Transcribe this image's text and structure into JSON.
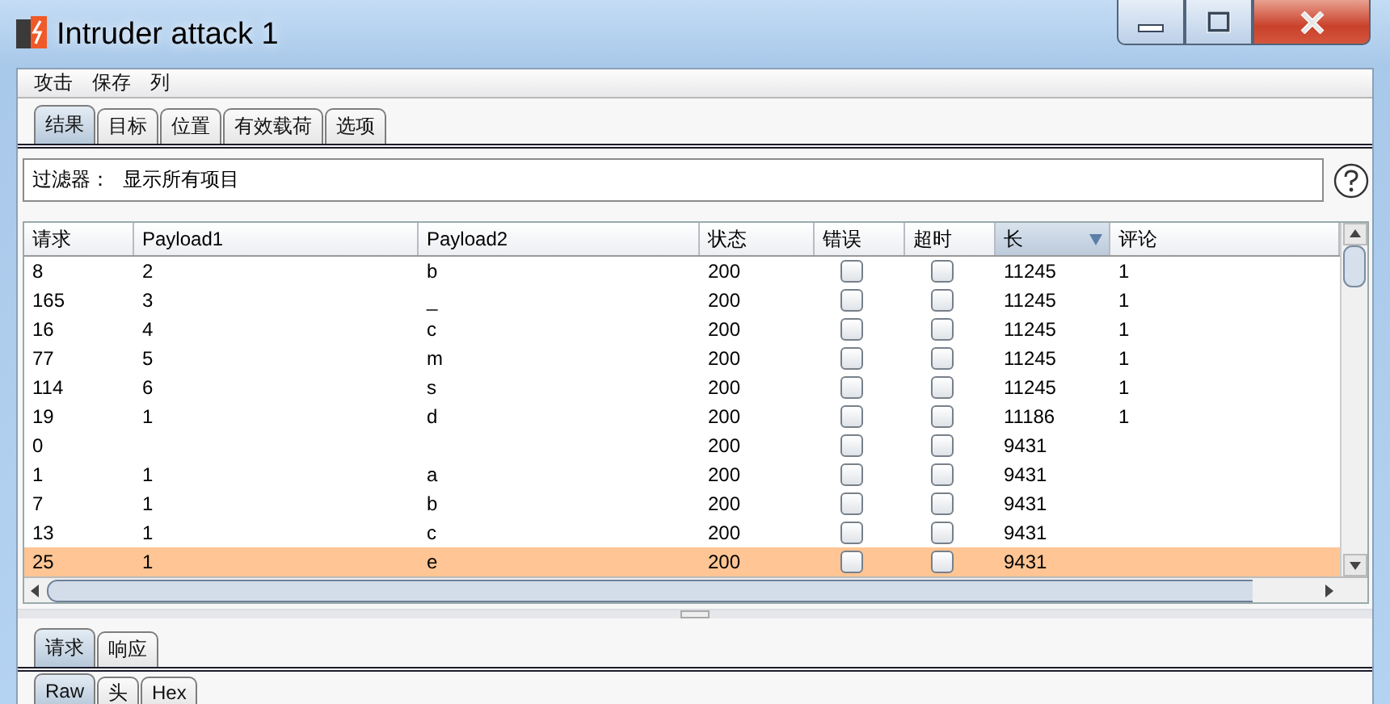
{
  "window": {
    "title": "Intruder attack 1"
  },
  "menu": [
    "攻击",
    "保存",
    "列"
  ],
  "tabs": [
    {
      "label": "结果",
      "selected": true
    },
    {
      "label": "目标",
      "selected": false
    },
    {
      "label": "位置",
      "selected": false
    },
    {
      "label": "有效载荷",
      "selected": false
    },
    {
      "label": "选项",
      "selected": false
    }
  ],
  "filter": {
    "label": "过滤器：",
    "value": "显示所有项目"
  },
  "table": {
    "columns": [
      {
        "label": "请求",
        "sorted": false
      },
      {
        "label": "Payload1",
        "sorted": false
      },
      {
        "label": "Payload2",
        "sorted": false
      },
      {
        "label": "状态",
        "sorted": false
      },
      {
        "label": "错误",
        "sorted": false
      },
      {
        "label": "超时",
        "sorted": false
      },
      {
        "label": "长",
        "sorted": true
      },
      {
        "label": "评论",
        "sorted": false
      }
    ],
    "rows": [
      {
        "request": "8",
        "payload1": "2",
        "payload2": "b",
        "status": "200",
        "error": false,
        "timeout": false,
        "length": "11245",
        "comment": "1",
        "selected": false
      },
      {
        "request": "165",
        "payload1": "3",
        "payload2": "_",
        "status": "200",
        "error": false,
        "timeout": false,
        "length": "11245",
        "comment": "1",
        "selected": false
      },
      {
        "request": "16",
        "payload1": "4",
        "payload2": "c",
        "status": "200",
        "error": false,
        "timeout": false,
        "length": "11245",
        "comment": "1",
        "selected": false
      },
      {
        "request": "77",
        "payload1": "5",
        "payload2": "m",
        "status": "200",
        "error": false,
        "timeout": false,
        "length": "11245",
        "comment": "1",
        "selected": false
      },
      {
        "request": "114",
        "payload1": "6",
        "payload2": "s",
        "status": "200",
        "error": false,
        "timeout": false,
        "length": "11245",
        "comment": "1",
        "selected": false
      },
      {
        "request": "19",
        "payload1": "1",
        "payload2": "d",
        "status": "200",
        "error": false,
        "timeout": false,
        "length": "11186",
        "comment": "1",
        "selected": false
      },
      {
        "request": "0",
        "status": "200",
        "error": false,
        "timeout": false,
        "length": "9431",
        "selected": false
      },
      {
        "request": "1",
        "payload1": "1",
        "payload2": "a",
        "status": "200",
        "error": false,
        "timeout": false,
        "length": "9431",
        "selected": false
      },
      {
        "request": "7",
        "payload1": "1",
        "payload2": "b",
        "status": "200",
        "error": false,
        "timeout": false,
        "length": "9431",
        "selected": false
      },
      {
        "request": "13",
        "payload1": "1",
        "payload2": "c",
        "status": "200",
        "error": false,
        "timeout": false,
        "length": "9431",
        "selected": false
      },
      {
        "request": "25",
        "payload1": "1",
        "payload2": "e",
        "status": "200",
        "error": false,
        "timeout": false,
        "length": "9431",
        "selected": true
      }
    ]
  },
  "message_tabs": [
    {
      "label": "请求",
      "selected": true
    },
    {
      "label": "响应",
      "selected": false
    }
  ],
  "view_tabs": [
    {
      "label": "Raw",
      "selected": true
    },
    {
      "label": "头",
      "selected": false
    },
    {
      "label": "Hex",
      "selected": false
    }
  ]
}
